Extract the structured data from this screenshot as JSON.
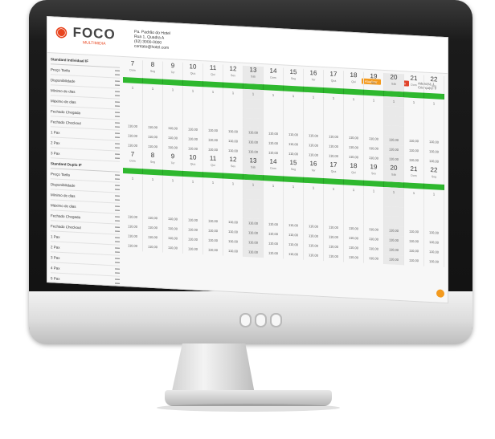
{
  "brand": {
    "logo": "FOCO",
    "tagline": "MULTIMIDIA"
  },
  "hotel": {
    "line1": "Pa. Padrão do Hotel",
    "line2": "Rua 1, Quadra A",
    "line3": "(62) 3000-0000",
    "line4": "contato@hotel.com"
  },
  "actions": {
    "btn1": "Atualizar",
    "btn2": "Desocupação",
    "select1": "Adulto(s): 1",
    "select2": "Criança(s): 0"
  },
  "section1": {
    "title": "Standard Individual IF",
    "rows": [
      "Preço Tarifa",
      "Disponibilidade",
      "Mínimo de dias",
      "Máximo de dias",
      "Fechado Chegada",
      "Fechado Checkout",
      "1 Pax",
      "2 Pax",
      "3 Pax"
    ]
  },
  "section2": {
    "title": "Standard Duplo IF",
    "rows": [
      "Preço Tarifa",
      "Disponibilidade",
      "Mínimo de dias",
      "Máximo de dias",
      "Fechado Chegada",
      "Fechado Checkout",
      "1 Pax",
      "2 Pax",
      "3 Pax",
      "4 Pax",
      "5 Pax"
    ]
  },
  "days": [
    {
      "n": "7",
      "w": "Dom"
    },
    {
      "n": "8",
      "w": "Seg"
    },
    {
      "n": "9",
      "w": "Ter"
    },
    {
      "n": "10",
      "w": "Qua"
    },
    {
      "n": "11",
      "w": "Qui"
    },
    {
      "n": "12",
      "w": "Sex"
    },
    {
      "n": "13",
      "w": "Sáb"
    },
    {
      "n": "14",
      "w": "Dom"
    },
    {
      "n": "15",
      "w": "Seg"
    },
    {
      "n": "16",
      "w": "Ter"
    },
    {
      "n": "17",
      "w": "Qua"
    },
    {
      "n": "18",
      "w": "Qui"
    },
    {
      "n": "19",
      "w": "Sex"
    },
    {
      "n": "20",
      "w": "Sáb"
    },
    {
      "n": "21",
      "w": "Dom"
    },
    {
      "n": "22",
      "w": "Seg"
    }
  ],
  "avail": [
    "1",
    "1",
    "1",
    "1",
    "1",
    "1",
    "1",
    "1",
    "1",
    "1",
    "1",
    "1",
    "1",
    "1",
    "1",
    "1"
  ],
  "price": "110,00"
}
